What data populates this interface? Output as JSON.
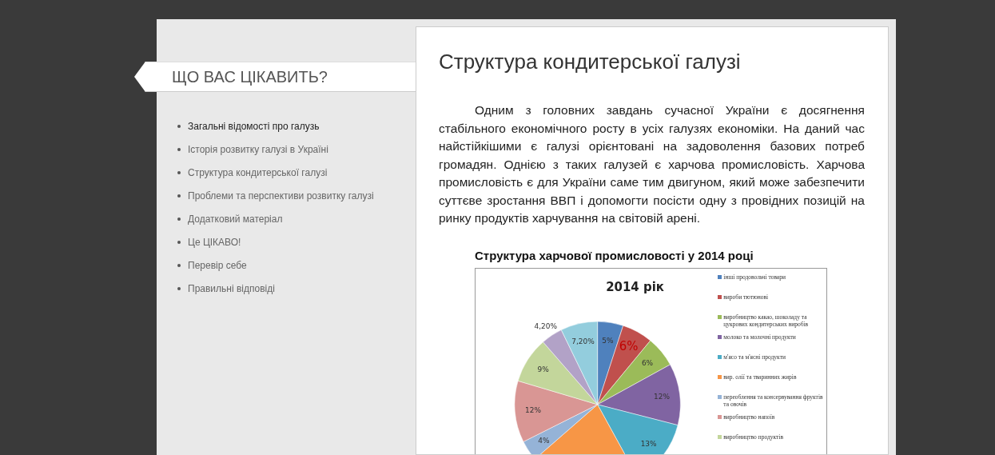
{
  "sidebar": {
    "heading": "ЩО ВАС ЦІКАВИТЬ?",
    "items": [
      {
        "label": "Загальні відомості про галузь",
        "selected": true
      },
      {
        "label": "Історія розвитку галузі в Україні",
        "selected": false
      },
      {
        "label": "Структура кондитерської галузі",
        "selected": false
      },
      {
        "label": "Проблеми та перспективи розвитку галузі",
        "selected": false
      },
      {
        "label": "Додатковий матеріал",
        "selected": false
      },
      {
        "label": "Це ЦІКАВО!",
        "selected": false
      },
      {
        "label": "Перевір себе",
        "selected": false
      },
      {
        "label": "Правильні відповіді",
        "selected": false
      }
    ]
  },
  "article": {
    "title": "Структура кондитерської галузі",
    "paragraph": "Одним з головних завдань сучасної України є досягнення стабільного економічного росту в усіх галузях економіки. На даний час найстійкішими є галузі орієнтовані на задоволення базових потреб громадян. Однією з таких галузей є харчова промисловість. Харчова промисловість є для України саме тим двигуном, який може забезпечити суттєве зростання ВВП і допомогти посісти одну з провідних позицій на ринку продуктів харчування на світовій арені.",
    "figure_caption": "Структура харчової промисловості у 2014 році",
    "chart_data": {
      "type": "pie",
      "title": "2014 рік",
      "categories": [
        "інші продовольчі товари",
        "вироби тютюнові",
        "виробництво какао, шоколаду та цукрових кондитерських виробів",
        "молоко та молочні продукти",
        "м'ясо та м'ясні продукти",
        "вир. олії та тваринних жирів",
        "переоблення та консервування фруктів та овочів",
        "виробництво напоїв",
        "виробництво продуктів",
        null,
        null
      ],
      "values": [
        5,
        6,
        6,
        12,
        13,
        21.6,
        4,
        12,
        9,
        4.2,
        7.2
      ],
      "value_labels": [
        "5%",
        null,
        "6%",
        "12%",
        "13%",
        null,
        "4%",
        "12%",
        "9%",
        "4,20%",
        "7,20%"
      ],
      "colors": [
        "#4f81bd",
        "#c0504d",
        "#9bbb59",
        "#8064a2",
        "#4bacc6",
        "#f79646",
        "#95b3d7",
        "#d99694",
        "#c3d69b",
        "#b2a2c7",
        "#93cddd"
      ],
      "legend": true,
      "annotations": [
        {
          "text": "6%",
          "x": "вироби тютюнові"
        }
      ]
    }
  }
}
